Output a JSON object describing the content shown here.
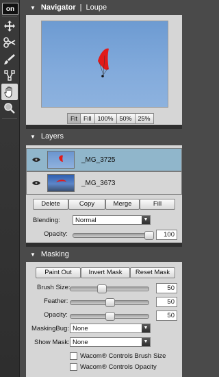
{
  "toolbar": {
    "logo_text": "on",
    "tools": [
      {
        "name": "move-tool-icon",
        "active": false
      },
      {
        "name": "scissors-tool-icon",
        "active": false
      },
      {
        "name": "brush-tool-icon",
        "active": false
      },
      {
        "name": "transform-tool-icon",
        "active": false
      },
      {
        "name": "hand-tool-icon",
        "active": true
      },
      {
        "name": "zoom-tool-icon",
        "active": false
      }
    ]
  },
  "navigator": {
    "title": "Navigator",
    "separator": "|",
    "tab2": "Loupe",
    "zoom_buttons": [
      "Fit",
      "Fill",
      "100%",
      "50%",
      "25%"
    ],
    "active_zoom": "Fit"
  },
  "layers": {
    "title": "Layers",
    "items": [
      {
        "name": "_MG_3725",
        "selected": true
      },
      {
        "name": "_MG_3673",
        "selected": false
      }
    ],
    "buttons": [
      "Delete",
      "Copy",
      "Merge",
      "Fill"
    ],
    "blending_label": "Blending:",
    "blending_value": "Normal",
    "opacity_label": "Opacity:",
    "opacity_value": "100",
    "opacity_fraction": 1.0
  },
  "masking": {
    "title": "Masking",
    "buttons": [
      "Paint Out",
      "Invert Mask",
      "Reset Mask"
    ],
    "sliders": [
      {
        "label": "Brush Size:",
        "value": "50",
        "fraction": 0.38
      },
      {
        "label": "Feather:",
        "value": "50",
        "fraction": 0.5
      },
      {
        "label": "Opacity:",
        "value": "50",
        "fraction": 0.5
      }
    ],
    "maskingbug_label": "MaskingBug:",
    "maskingbug_value": "None",
    "showmask_label": "Show Mask:",
    "showmask_value": "None",
    "check1": "Wacom® Controls Brush Size",
    "check2": "Wacom® Controls Opacity"
  },
  "colors": {
    "panel_bg": "#d6d6d6",
    "selected_layer": "#90b6cb",
    "sky": "#7ea6d8",
    "parachute": "#e21a1a"
  }
}
